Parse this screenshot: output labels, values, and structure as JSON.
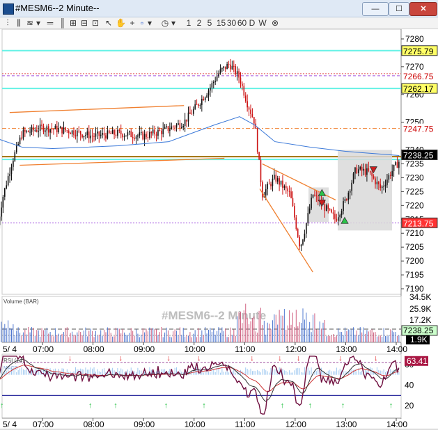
{
  "window": {
    "title": "#MESM6--2 Minute--",
    "min": "—",
    "max": "☐",
    "close": "✕"
  },
  "toolbar": {
    "intervals": [
      "1",
      "2",
      "5",
      "15",
      "30",
      "60",
      "D",
      "W"
    ]
  },
  "chart": {
    "watermark": "#MESM6--2 Minute",
    "price_axis": [
      "7280",
      "7270",
      "7260",
      "7250",
      "7240",
      "7235",
      "7230",
      "7225",
      "7220",
      "7215",
      "7210",
      "7205",
      "7200",
      "7195",
      "7190"
    ],
    "price_ticks": [
      7280,
      7270,
      7260,
      7250,
      7240,
      7235,
      7230,
      7225,
      7220,
      7215,
      7210,
      7205,
      7200,
      7195,
      7190
    ],
    "price_labels": [
      {
        "text": "7275.79",
        "price": 7275.79,
        "bg": "#ffff66",
        "fg": "#000000"
      },
      {
        "text": "7266.75",
        "price": 7266.75,
        "bg": "#ffffff",
        "fg": "#cc0000"
      },
      {
        "text": "7262.17",
        "price": 7262.17,
        "bg": "#ffff66",
        "fg": "#000000"
      },
      {
        "text": "7247.75",
        "price": 7247.75,
        "bg": "#ffffff",
        "fg": "#cc0000"
      },
      {
        "text": "7238.25",
        "price": 7238.25,
        "bg": "#000000",
        "fg": "#ffffff"
      },
      {
        "text": "7213.75",
        "price": 7213.75,
        "bg": "#ff3333",
        "fg": "#ffffff"
      }
    ],
    "time_labels": [
      "5/ 4",
      "07:00",
      "08:00",
      "09:00",
      "10:00",
      "11:00",
      "12:00",
      "13:00",
      "14:00"
    ],
    "colors": {
      "up": "#111111",
      "down": "#cc1111",
      "cyan": "#66f2e6",
      "orange": "#f08030",
      "purple": "#a050e0",
      "ma": "#3a78d8"
    }
  },
  "volume": {
    "label": "Volume (BAR)",
    "axis": [
      "34.5K",
      "25.9K",
      "17.2K"
    ],
    "last_label": "7238.25",
    "current": "1.9K"
  },
  "rsi": {
    "label": "RSI (14)",
    "sublabel": "MACD",
    "axis": [
      "60",
      "40",
      "20"
    ],
    "last": "63.41"
  }
}
